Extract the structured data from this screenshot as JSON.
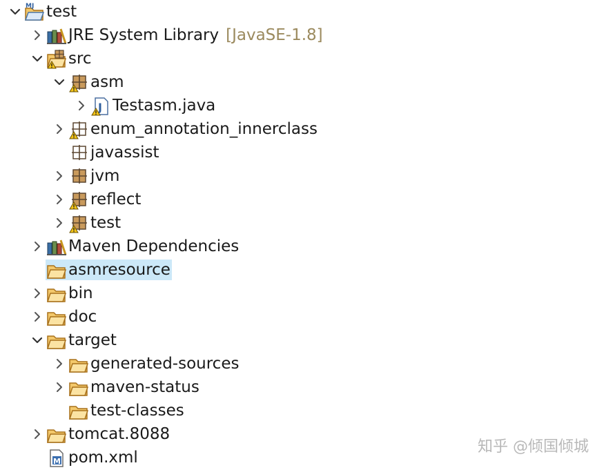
{
  "tree": [
    {
      "label": "test",
      "icon": "java-project-icon",
      "expanded": true,
      "depth": 0
    },
    {
      "label": "JRE System Library",
      "decoration": "[JavaSE-1.8]",
      "icon": "library-icon",
      "expanded": false,
      "depth": 1
    },
    {
      "label": "src",
      "icon": "source-folder-warning-icon",
      "expanded": true,
      "depth": 1
    },
    {
      "label": "asm",
      "icon": "package-warning-icon",
      "expanded": true,
      "depth": 2
    },
    {
      "label": "Testasm.java",
      "icon": "java-file-warning-icon",
      "expanded": false,
      "depth": 3
    },
    {
      "label": "enum_annotation_innerclass",
      "icon": "empty-package-warning-icon",
      "expanded": false,
      "depth": 2
    },
    {
      "label": "javassist",
      "icon": "empty-package-icon",
      "expanded": null,
      "depth": 2
    },
    {
      "label": "jvm",
      "icon": "package-icon",
      "expanded": false,
      "depth": 2
    },
    {
      "label": "reflect",
      "icon": "package-warning-icon",
      "expanded": false,
      "depth": 2
    },
    {
      "label": "test",
      "icon": "package-warning-icon",
      "expanded": false,
      "depth": 2
    },
    {
      "label": "Maven Dependencies",
      "icon": "library-icon",
      "expanded": false,
      "depth": 1
    },
    {
      "label": "asmresource",
      "icon": "folder-icon",
      "expanded": null,
      "depth": 1,
      "selected": true
    },
    {
      "label": "bin",
      "icon": "folder-icon",
      "expanded": false,
      "depth": 1
    },
    {
      "label": "doc",
      "icon": "folder-icon",
      "expanded": false,
      "depth": 1
    },
    {
      "label": "target",
      "icon": "folder-icon",
      "expanded": true,
      "depth": 1
    },
    {
      "label": "generated-sources",
      "icon": "folder-icon",
      "expanded": false,
      "depth": 2
    },
    {
      "label": "maven-status",
      "icon": "folder-icon",
      "expanded": false,
      "depth": 2
    },
    {
      "label": "test-classes",
      "icon": "folder-icon",
      "expanded": null,
      "depth": 2
    },
    {
      "label": "tomcat.8088",
      "icon": "folder-icon",
      "expanded": false,
      "depth": 1
    },
    {
      "label": "pom.xml",
      "icon": "maven-pom-icon",
      "expanded": null,
      "depth": 1
    }
  ],
  "watermark": "知乎 @倾国倾城",
  "colors": {
    "selection": "#cce8f8",
    "decoration": "#9b8a5e",
    "folder_fill": "#f6d487",
    "folder_stroke": "#b07a1e",
    "package_fill": "#c79a5a",
    "warning": "#f5c518"
  }
}
